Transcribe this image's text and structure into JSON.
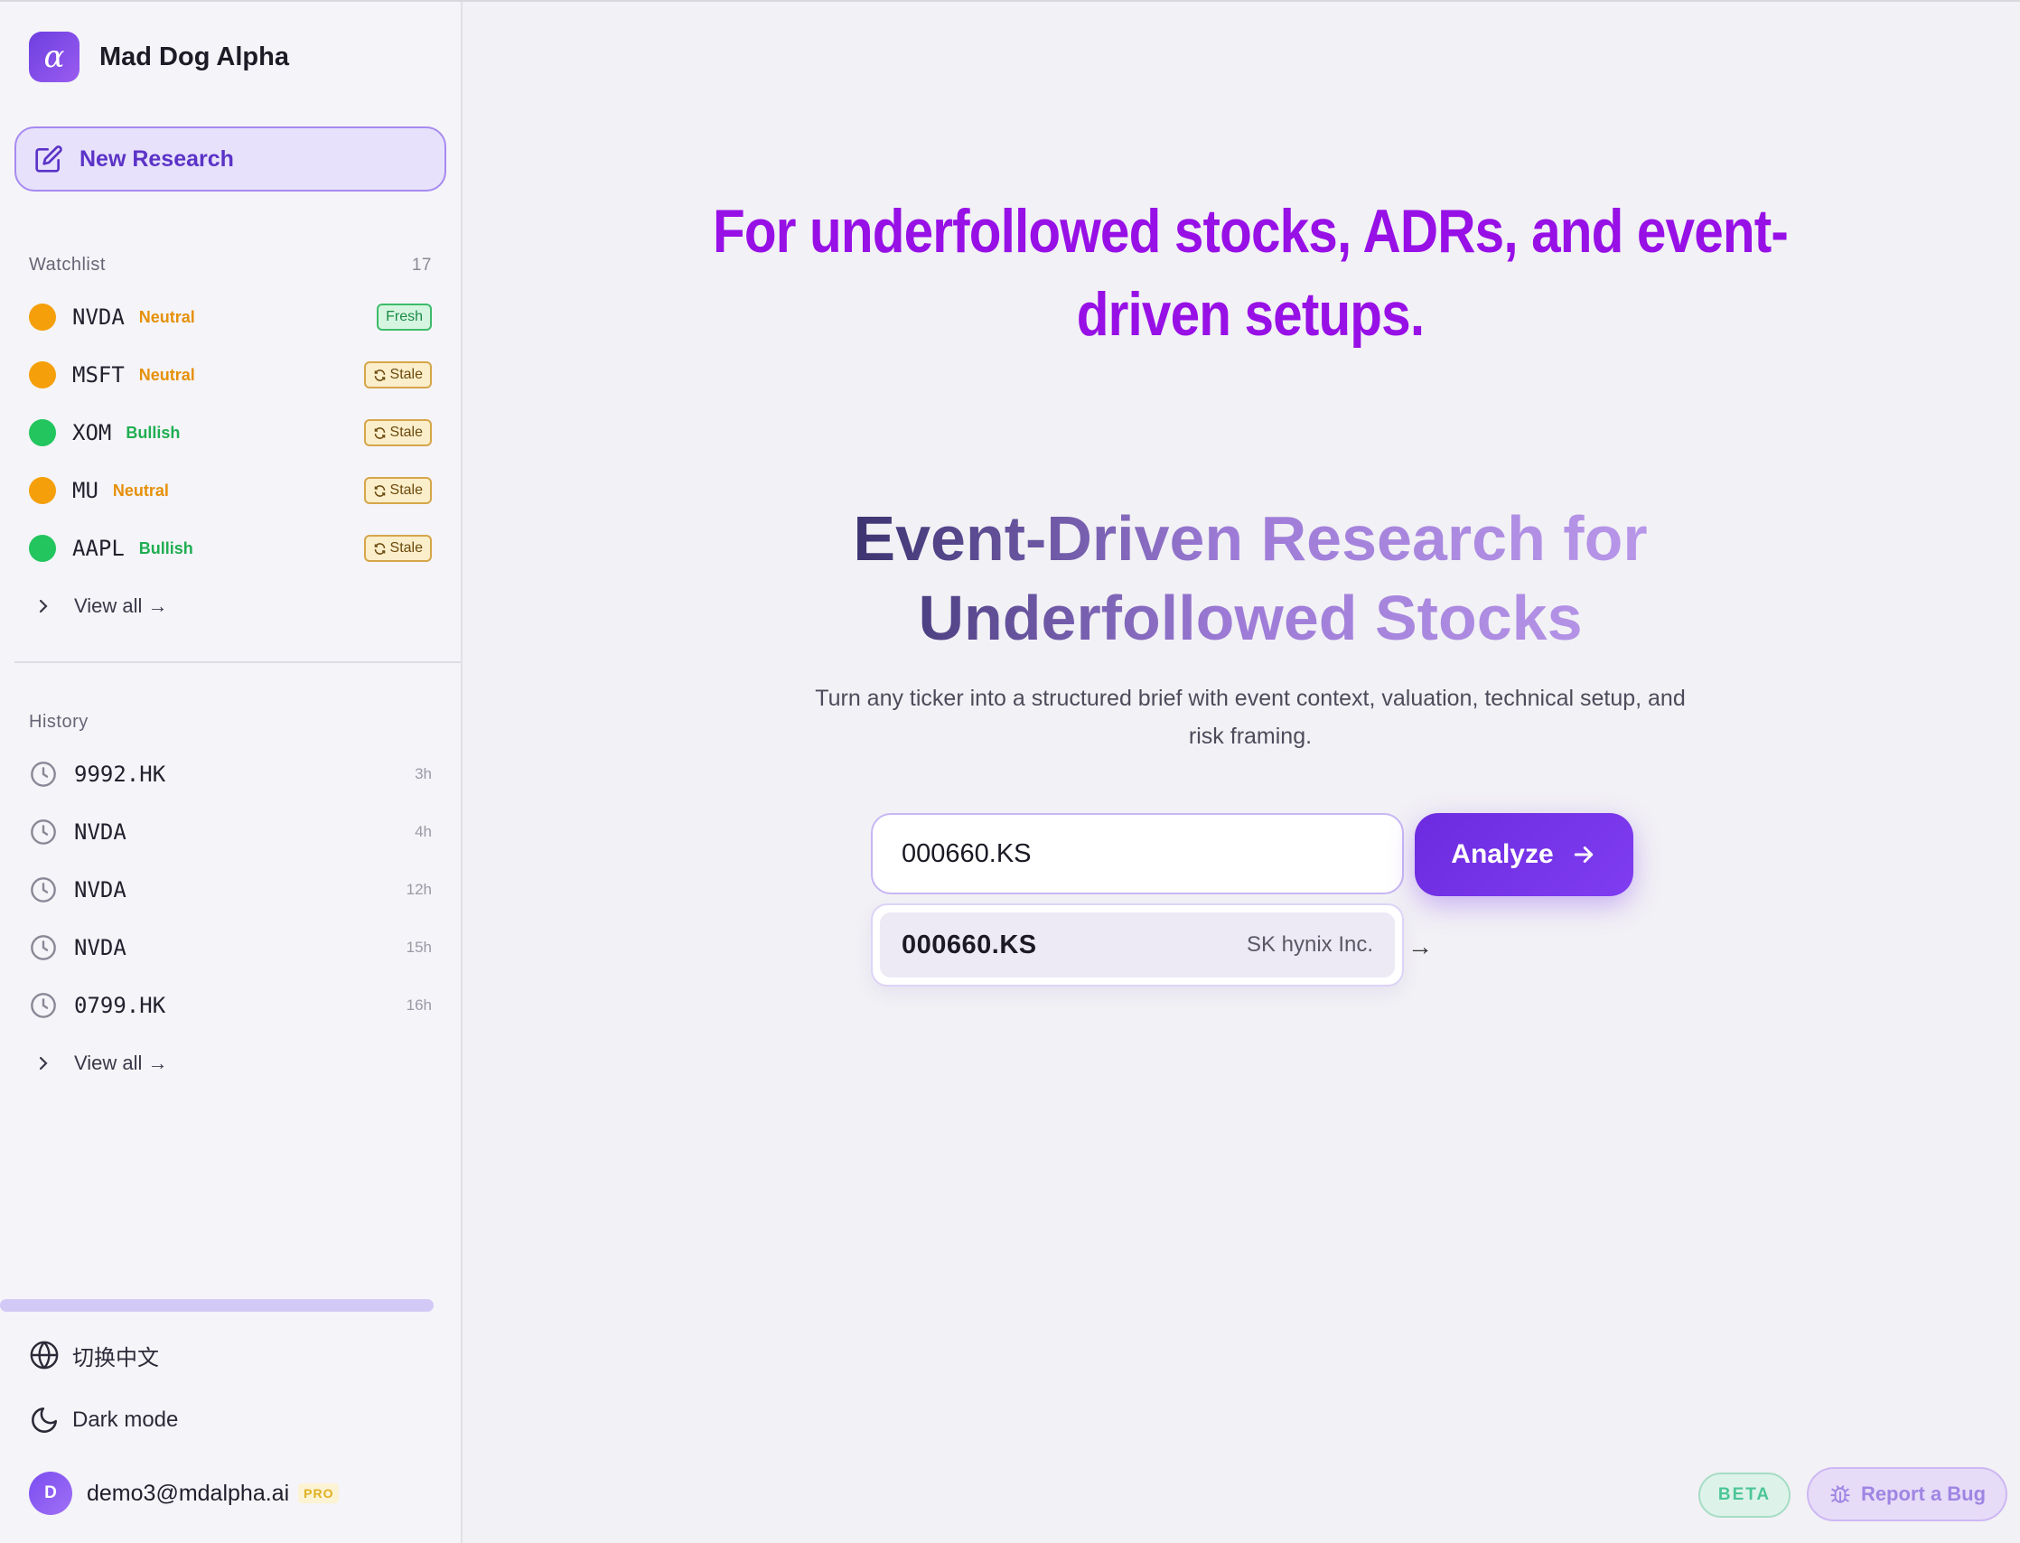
{
  "brand": {
    "name": "Mad Dog Alpha",
    "logo_glyph": "α"
  },
  "sidebar": {
    "new_research_label": "New Research",
    "watchlist": {
      "title": "Watchlist",
      "count": "17",
      "items": [
        {
          "ticker": "NVDA",
          "sentiment": "Neutral",
          "badge": "Fresh"
        },
        {
          "ticker": "MSFT",
          "sentiment": "Neutral",
          "badge": "Stale"
        },
        {
          "ticker": "XOM",
          "sentiment": "Bullish",
          "badge": "Stale"
        },
        {
          "ticker": "MU",
          "sentiment": "Neutral",
          "badge": "Stale"
        },
        {
          "ticker": "AAPL",
          "sentiment": "Bullish",
          "badge": "Stale"
        }
      ],
      "view_all": "View all →"
    },
    "history": {
      "title": "History",
      "items": [
        {
          "ticker": "9992.HK",
          "age": "3h"
        },
        {
          "ticker": "NVDA",
          "age": "4h"
        },
        {
          "ticker": "NVDA",
          "age": "12h"
        },
        {
          "ticker": "NVDA",
          "age": "15h"
        },
        {
          "ticker": "0799.HK",
          "age": "16h"
        }
      ],
      "view_all": "View all →"
    },
    "language_toggle": "切换中文",
    "dark_mode": "Dark mode",
    "user": {
      "initial": "D",
      "email": "demo3@mdalpha.ai",
      "plan": "PRO"
    }
  },
  "main": {
    "hero_top": "For underfollowed stocks, ADRs, and event-driven setups.",
    "headline": "Event-Driven Research for Underfollowed Stocks",
    "subline": "Turn any ticker into a structured brief with event context, valuation, technical setup, and risk framing.",
    "search": {
      "value": "000660.KS",
      "placeholder": ""
    },
    "analyze_label": "Analyze",
    "suggestion": {
      "ticker": "000660.KS",
      "name": "SK hynix Inc."
    },
    "floating_arrow": "→"
  },
  "footer": {
    "beta": "BETA",
    "report_bug": "Report a Bug"
  },
  "colors": {
    "accent": "#7c3aed",
    "hero_purple": "#9710e6",
    "neutral": "#f59f0a",
    "bullish": "#22c55e"
  }
}
